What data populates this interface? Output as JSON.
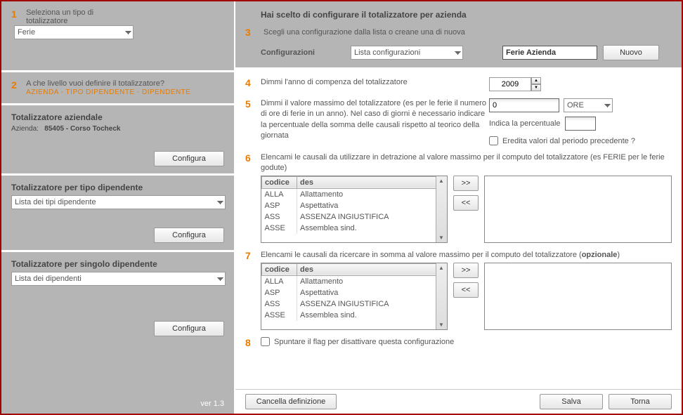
{
  "sidebar": {
    "step1": {
      "num": "1",
      "label": "Seleziona un tipo di totalizzatore",
      "select_value": "Ferie"
    },
    "step2": {
      "num": "2",
      "label": "A che livello vuoi definire il totalizzatore?",
      "sub": "AZIENDA - TIPO DIPENDENTE - DIPENDENTE"
    },
    "azienda": {
      "heading": "Totalizzatore aziendale",
      "prefix": "Azienda:",
      "code": "85405 - Corso Tocheck",
      "button": "Configura"
    },
    "tipodip": {
      "heading": "Totalizzatore per tipo dipendente",
      "select_value": "Lista dei tipi dipendente",
      "button": "Configura"
    },
    "singolo": {
      "heading": "Totalizzatore per singolo dipendente",
      "select_value": "Lista dei dipendenti",
      "button": "Configura"
    },
    "version": "ver 1.3"
  },
  "header": {
    "title": "Hai scelto di configurare il totalizzatore per azienda",
    "step3num": "3",
    "step3label": "Scegli una configurazione dalla lista o creane una di nuova",
    "cfg_label": "Configurazioni",
    "cfg_select": "Lista configurazioni",
    "cfg_name": "Ferie Azienda",
    "nuovo": "Nuovo"
  },
  "body": {
    "s4": {
      "num": "4",
      "label": "Dimmi l'anno di compenza del totalizzatore",
      "year": "2009"
    },
    "s5": {
      "num": "5",
      "label": "Dimmi il valore massimo del totalizzatore (es per le ferie il numero di ore di ferie in un anno). Nel caso di giorni è necessario indicare la percentuale della somma delle causali rispetto al teorico della giornata",
      "value": "0",
      "unit": "ORE",
      "perc_label": "Indica la percentuale",
      "inherit_label": "Eredita valori dal periodo precedente ?"
    },
    "s6": {
      "num": "6",
      "label": "Elencami le causali da utilizzare in detrazione al valore massimo per il computo del totalizzatore (es FERIE per le ferie godute)",
      "col_code": "codice",
      "col_des": "des",
      "rows": [
        {
          "code": "ALLA",
          "des": "Allattamento"
        },
        {
          "code": "ASP",
          "des": "Aspettativa"
        },
        {
          "code": "ASS",
          "des": "ASSENZA INGIUSTIFICA"
        },
        {
          "code": "ASSE",
          "des": "Assemblea sind."
        }
      ],
      "add": ">>",
      "rem": "<<"
    },
    "s7": {
      "num": "7",
      "label_a": "Elencami le causali da ricercare in somma al valore massimo per il computo del totalizzatore (",
      "label_b": "opzionale",
      "label_c": ")",
      "col_code": "codice",
      "col_des": "des",
      "rows": [
        {
          "code": "ALLA",
          "des": "Allattamento"
        },
        {
          "code": "ASP",
          "des": "Aspettativa"
        },
        {
          "code": "ASS",
          "des": "ASSENZA INGIUSTIFICA"
        },
        {
          "code": "ASSE",
          "des": "Assemblea sind."
        }
      ],
      "add": ">>",
      "rem": "<<"
    },
    "s8": {
      "num": "8",
      "label": "Spuntare il flag per disattivare questa configurazione"
    }
  },
  "footer": {
    "cancel": "Cancella definizione",
    "save": "Salva",
    "back": "Torna"
  }
}
